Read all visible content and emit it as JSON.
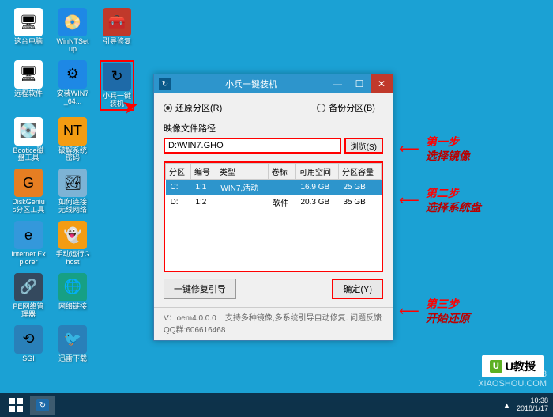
{
  "desktop": {
    "r1": [
      {
        "label": "这台电脑",
        "bg": "#fff",
        "glyph": "🖥"
      },
      {
        "label": "WinNTSetup",
        "bg": "#1e88e5",
        "glyph": "📀"
      },
      {
        "label": "引导修复",
        "bg": "#c0392b",
        "glyph": "🧰"
      }
    ],
    "r2": [
      {
        "label": "远程软件",
        "bg": "#fff",
        "glyph": "🖥"
      },
      {
        "label": "安装WIN7_64...",
        "bg": "#1e88e5",
        "glyph": "⚙"
      },
      {
        "label": "小兵一键装机",
        "bg": "#1e6aa8",
        "glyph": "↻",
        "hl": true
      }
    ],
    "r3": [
      {
        "label": "Bootice磁盘工具",
        "bg": "#fff",
        "glyph": "💽"
      },
      {
        "label": "破解系统密码",
        "bg": "#f39c12",
        "glyph": "NT"
      }
    ],
    "r4": [
      {
        "label": "DiskGenius分区工具",
        "bg": "#e67e22",
        "glyph": "G"
      },
      {
        "label": "如何连接无线网络",
        "bg": "#7db3d5",
        "glyph": "🏞"
      }
    ],
    "r5": [
      {
        "label": "Internet Explorer",
        "bg": "#3498db",
        "glyph": "e"
      },
      {
        "label": "手动运行Ghost",
        "bg": "#f39c12",
        "glyph": "👻"
      }
    ],
    "r6": [
      {
        "label": "PE网络管理器",
        "bg": "#34495e",
        "glyph": "🔗"
      },
      {
        "label": "网络链接",
        "bg": "#16a085",
        "glyph": "🌐"
      }
    ],
    "r7": [
      {
        "label": "SGI",
        "bg": "#2980b9",
        "glyph": "⟲"
      },
      {
        "label": "迅雷下载",
        "bg": "#2980b9",
        "glyph": "🐦"
      }
    ]
  },
  "window": {
    "title": "小兵一键装机",
    "radio_restore": "还原分区(R)",
    "radio_backup": "备份分区(B)",
    "path_label": "映像文件路径",
    "path_value": "D:\\WIN7.GHO",
    "browse": "浏览(S)",
    "cols": [
      "分区",
      "编号",
      "类型",
      "卷标",
      "可用空间",
      "分区容量"
    ],
    "rows": [
      {
        "p": "C:",
        "n": "1:1",
        "t": "WIN7,活动",
        "v": "",
        "f": "16.9 GB",
        "c": "25 GB",
        "sel": true
      },
      {
        "p": "D:",
        "n": "1:2",
        "t": "",
        "v": "软件",
        "f": "20.3 GB",
        "c": "35 GB",
        "sel": false
      }
    ],
    "repair_btn": "一键修复引导",
    "ok_btn": "确定(Y)",
    "status_v": "V：oem4.0.0.0",
    "status_txt": "支持多种镜像,多系统引导自动修复. 问题反馈QQ群:606616468"
  },
  "anno": {
    "s1a": "第一步",
    "s1b": "选择镜像",
    "s2a": "第二步",
    "s2b": "选择系统盘",
    "s3a": "第三步",
    "s3b": "开始还原"
  },
  "taskbar": {
    "time": "10:38",
    "date": "2018/1/17"
  },
  "watermark": {
    "l1": "Windows 8",
    "l2": "XIAOSHOU.COM"
  },
  "logo": "U教授"
}
